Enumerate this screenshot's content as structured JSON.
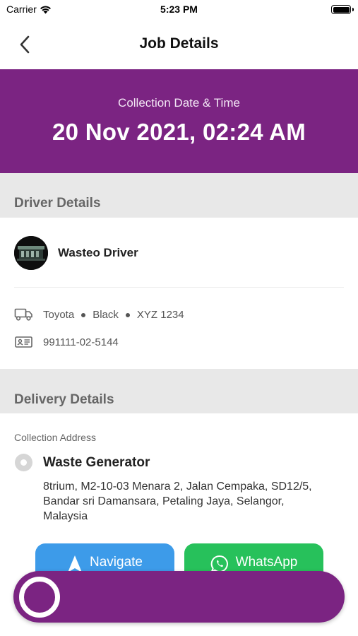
{
  "status_bar": {
    "carrier": "Carrier",
    "time": "5:23 PM"
  },
  "nav": {
    "title": "Job Details"
  },
  "hero": {
    "label": "Collection Date & Time",
    "datetime": "20 Nov 2021, 02:24 AM",
    "color": "#7b2482"
  },
  "driver_section": {
    "heading": "Driver Details",
    "name": "Wasteo Driver",
    "vehicle": {
      "make": "Toyota",
      "color": "Black",
      "plate": "XYZ 1234"
    },
    "id_number": "991111-02-5144"
  },
  "delivery_section": {
    "heading": "Delivery Details",
    "address_label": "Collection Address",
    "generator_name": "Waste Generator",
    "address": "8trium, M2-10-03 Menara 2, Jalan Cempaka, SD12/5, Bandar sri Damansara,  Petaling Jaya, Selangor, Malaysia"
  },
  "buttons": {
    "navigate": "Navigate",
    "whatsapp": "WhatsApp",
    "navigate_color": "#3d9be9",
    "whatsapp_color": "#27c15b"
  },
  "icons": {
    "back": "chevron-left-icon",
    "truck": "truck-icon",
    "id_card": "id-card-icon",
    "location": "location-pin-icon",
    "navigate": "navigation-arrow-icon",
    "whatsapp": "whatsapp-icon",
    "wifi": "wifi-icon",
    "battery": "battery-icon"
  }
}
